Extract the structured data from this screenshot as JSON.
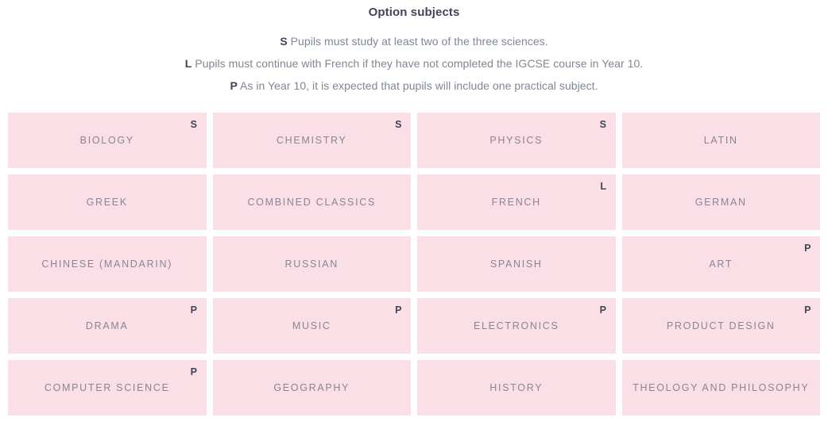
{
  "header": {
    "title": "Option subjects",
    "legend": [
      {
        "key": "S",
        "text": " Pupils must study at least two of the three sciences."
      },
      {
        "key": "L",
        "text": " Pupils must continue with French if they have not completed the IGCSE course in Year 10."
      },
      {
        "key": "P",
        "text": " As in Year 10, it is expected that pupils will include one practical subject."
      }
    ]
  },
  "colors": {
    "tile_background": "#fbdfe6",
    "tile_label": "#8a8496",
    "marker": "#3f4555",
    "legend_text": "#7e8794",
    "page_background": "#ffffff"
  },
  "grid": {
    "columns": 4,
    "rows": 5,
    "tiles": [
      {
        "label": "BIOLOGY",
        "marker": "S"
      },
      {
        "label": "CHEMISTRY",
        "marker": "S"
      },
      {
        "label": "PHYSICS",
        "marker": "S"
      },
      {
        "label": "LATIN",
        "marker": ""
      },
      {
        "label": "GREEK",
        "marker": ""
      },
      {
        "label": "COMBINED CLASSICS",
        "marker": ""
      },
      {
        "label": "FRENCH",
        "marker": "L"
      },
      {
        "label": "GERMAN",
        "marker": ""
      },
      {
        "label": "CHINESE (MANDARIN)",
        "marker": ""
      },
      {
        "label": "RUSSIAN",
        "marker": ""
      },
      {
        "label": "SPANISH",
        "marker": ""
      },
      {
        "label": "ART",
        "marker": "P"
      },
      {
        "label": "DRAMA",
        "marker": "P"
      },
      {
        "label": "MUSIC",
        "marker": "P"
      },
      {
        "label": "ELECTRONICS",
        "marker": "P"
      },
      {
        "label": "PRODUCT DESIGN",
        "marker": "P"
      },
      {
        "label": "COMPUTER SCIENCE",
        "marker": "P"
      },
      {
        "label": "GEOGRAPHY",
        "marker": ""
      },
      {
        "label": "HISTORY",
        "marker": ""
      },
      {
        "label": "THEOLOGY AND PHILOSOPHY",
        "marker": ""
      }
    ]
  }
}
